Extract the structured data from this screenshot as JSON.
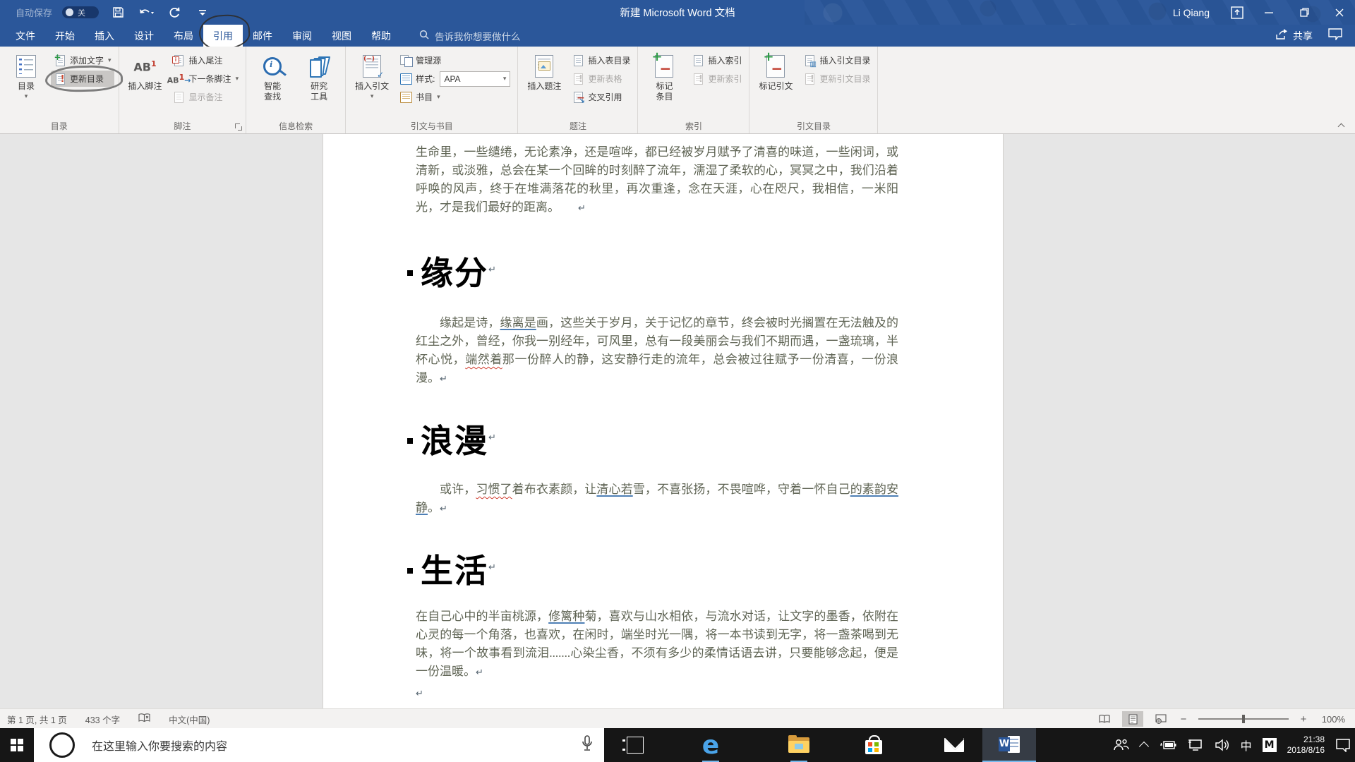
{
  "colors": {
    "accent_blue": "#2b579a",
    "ribbon_bg": "#f3f2f1",
    "doc_canvas": "#e6e6e6",
    "body_text": "#5f6454",
    "underline_blue": "#4e7fb5",
    "squiggly_red": "#d03c2e",
    "taskbar_bg": "#161616",
    "running_indicator": "#76b9ed"
  },
  "titlebar": {
    "autosave_label": "自动保存",
    "autosave_state": "关",
    "title": "新建 Microsoft Word 文档",
    "user": "Li Qiang"
  },
  "tabs": {
    "items": [
      {
        "label": "文件"
      },
      {
        "label": "开始"
      },
      {
        "label": "插入"
      },
      {
        "label": "设计"
      },
      {
        "label": "布局"
      },
      {
        "label": "引用"
      },
      {
        "label": "邮件"
      },
      {
        "label": "审阅"
      },
      {
        "label": "视图"
      },
      {
        "label": "帮助"
      }
    ],
    "active_index": 5,
    "search_placeholder": "告诉我你想要做什么",
    "share_label": "共享"
  },
  "annotations": {
    "circled_tab": "引用",
    "circled_button": "更新目录"
  },
  "ribbon": {
    "groups": [
      {
        "label": "目录",
        "name": "table-of-contents",
        "big": [
          {
            "name": "toc-button",
            "lines": [
              "目录"
            ],
            "arrow": true,
            "icon": "toc"
          }
        ],
        "small": [
          {
            "name": "add-text-button",
            "label": "添加文字",
            "arrow": true,
            "icon": "add-text"
          },
          {
            "name": "update-toc-button",
            "label": "更新目录",
            "icon": "update",
            "circled": true
          }
        ]
      },
      {
        "label": "脚注",
        "name": "footnotes",
        "launcher": true,
        "big": [
          {
            "name": "insert-footnote-button",
            "lines": [
              "插入脚注"
            ],
            "icon": "ab1"
          }
        ],
        "small": [
          {
            "name": "insert-endnote-button",
            "label": "插入尾注",
            "icon": "endnote"
          },
          {
            "name": "next-footnote-button",
            "label": "下一条脚注",
            "arrow": true,
            "icon": "ab1-next"
          },
          {
            "name": "show-notes-button",
            "label": "显示备注",
            "disabled": true,
            "icon": "page-dis"
          }
        ]
      },
      {
        "label": "信息检索",
        "name": "research",
        "big": [
          {
            "name": "smart-lookup-button",
            "lines": [
              "智能",
              "查找"
            ],
            "icon": "lens"
          },
          {
            "name": "research-tools-button",
            "lines": [
              "研究",
              "工具"
            ],
            "icon": "books"
          }
        ],
        "small": []
      },
      {
        "label": "引文与书目",
        "name": "citations-bibliography",
        "big": [
          {
            "name": "insert-citation-button",
            "lines": [
              "插入引文"
            ],
            "arrow": true,
            "icon": "citation"
          }
        ],
        "small": [
          {
            "name": "manage-sources-button",
            "label": "管理源",
            "icon": "sources"
          },
          {
            "name": "style-combo",
            "label": "样式:",
            "icon": "stylebook",
            "combo": "APA"
          },
          {
            "name": "bibliography-button",
            "label": "书目",
            "arrow": true,
            "icon": "biblio"
          }
        ]
      },
      {
        "label": "题注",
        "name": "captions",
        "big": [
          {
            "name": "insert-caption-button",
            "lines": [
              "插入题注"
            ],
            "icon": "caption"
          }
        ],
        "small": [
          {
            "name": "insert-table-of-figures-button",
            "label": "插入表目录",
            "icon": "page"
          },
          {
            "name": "update-table-button",
            "label": "更新表格",
            "disabled": true,
            "icon": "update-dis"
          },
          {
            "name": "cross-reference-button",
            "label": "交叉引用",
            "icon": "crossref"
          }
        ]
      },
      {
        "label": "索引",
        "name": "index",
        "big": [
          {
            "name": "mark-entry-button",
            "lines": [
              "标记",
              "条目"
            ],
            "icon": "markdoc"
          }
        ],
        "small": [
          {
            "name": "insert-index-button",
            "label": "插入索引",
            "icon": "page"
          },
          {
            "name": "update-index-button",
            "label": "更新索引",
            "disabled": true,
            "icon": "update-dis"
          }
        ]
      },
      {
        "label": "引文目录",
        "name": "table-of-authorities",
        "big": [
          {
            "name": "mark-citation-button",
            "lines": [
              "标记引文"
            ],
            "icon": "markdoc"
          }
        ],
        "small": [
          {
            "name": "insert-table-of-authorities-button",
            "label": "插入引文目录",
            "icon": "toa"
          },
          {
            "name": "update-table-of-authorities-button",
            "label": "更新引文目录",
            "disabled": true,
            "icon": "update-dis"
          }
        ]
      }
    ]
  },
  "document": {
    "pilcrow": "↵",
    "paragraphs": [
      {
        "type": "body",
        "cls": "",
        "indent": false,
        "pilcrow_gap": true,
        "runs": [
          {
            "t": "生命里，一些缱绻，无论素净，还是喧哗，都已经被岁月赋予了清喜的味道，一些闲词，或清新，或淡雅，总会在某一个回眸的时刻醉了流年，濡湿了柔软的心，冥冥之中，我们沿着呼唤的风声，终于在堆满落花的秋里，再次重逢，念在天涯，心在咫尺，我相信，一米阳光，才是我们最好的距离。",
            "s": ""
          }
        ]
      },
      {
        "type": "h",
        "cls": "mt-h1",
        "text": "缘分"
      },
      {
        "type": "body",
        "cls": "mt-p2",
        "indent": true,
        "runs": [
          {
            "t": "缘起是诗，",
            "s": ""
          },
          {
            "t": "缘离是",
            "s": "u"
          },
          {
            "t": "画，这些关于岁月，关于记忆的章节，终会被时光搁置在无法触及的红尘之外，曾经，你我一别经年，可风里，总有一段美丽会与我们不期而遇，一盏琉璃，半杯心悦，",
            "s": ""
          },
          {
            "t": "端然着",
            "s": "u sq"
          },
          {
            "t": "那一份醉人的静，这安静行走的流年，总会被过往赋予一份清喜，一份浪漫。",
            "s": ""
          }
        ]
      },
      {
        "type": "h",
        "cls": "m-h",
        "text": "浪漫"
      },
      {
        "type": "body",
        "cls": "m-p",
        "indent": true,
        "runs": [
          {
            "t": "或许，",
            "s": ""
          },
          {
            "t": "习惯了",
            "s": "sq"
          },
          {
            "t": "着布衣素颜，让",
            "s": ""
          },
          {
            "t": "清心若",
            "s": "u"
          },
          {
            "t": "雪，不喜张扬，不畏喧哗，守着一怀自己",
            "s": ""
          },
          {
            "t": "的素韵安静",
            "s": "u"
          },
          {
            "t": "。",
            "s": ""
          }
        ]
      },
      {
        "type": "h",
        "cls": "m-h",
        "text": "生活"
      },
      {
        "type": "body",
        "cls": "mt-p4",
        "indent": false,
        "runs": [
          {
            "t": "在自己心中的半亩桃源，",
            "s": ""
          },
          {
            "t": "修篱种",
            "s": "u"
          },
          {
            "t": "菊，喜欢与山水相依，与流水对话，让文字的墨香，依附在心灵的每一个角落，也喜欢，在闲时，端坐时光一隅，将一本书读到无字，将一盏茶喝到无味，将一个故事看到流泪.......心染尘香，不须有多少的柔情话语去讲，只要能够念起，便是一份温暖。",
            "s": ""
          }
        ]
      },
      {
        "type": "body",
        "cls": "mt-last",
        "indent": false,
        "runs": []
      }
    ]
  },
  "statusbar": {
    "page_info": "第 1 页, 共 1 页",
    "word_count": "433 个字",
    "language": "中文(中国)",
    "zoom_value": "100%",
    "zoom_minus": "−",
    "zoom_plus": "+"
  },
  "taskbar": {
    "search_placeholder": "在这里输入你要搜索的内容",
    "ime_lang": "中",
    "ime_mode": "M",
    "time": "21:38",
    "date": "2018/8/16"
  }
}
